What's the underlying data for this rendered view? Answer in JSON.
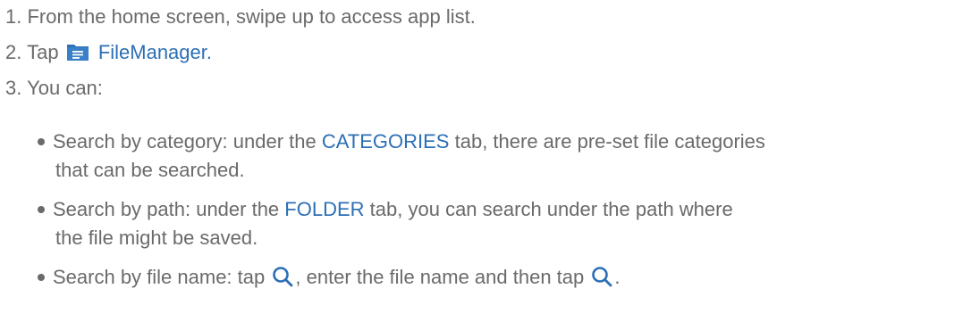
{
  "steps": [
    {
      "number": "1.",
      "text": "From the home screen, swipe up to access app list."
    },
    {
      "number": "2.",
      "prefix": "Tap",
      "app_name": "FileManager.",
      "icon": "folder-icon"
    },
    {
      "number": "3.",
      "text": "You can:"
    }
  ],
  "options": [
    {
      "lead": "Search by category: under the",
      "keyword": "CATEGORIES",
      "rest": "tab, there are pre-set file categories",
      "continuation": "that can be searched."
    },
    {
      "lead": "Search by path: under the",
      "keyword": "FOLDER",
      "rest": "tab, you can search under the path where",
      "continuation": "the file might be saved."
    },
    {
      "lead": "Search by file name: tap",
      "middle": ", enter the file name and then tap",
      "end": ".",
      "icon": "search-icon"
    }
  ],
  "colors": {
    "body_text": "#6a6a6a",
    "keyword": "#2c6fb5",
    "icon": "#2c6fb5"
  }
}
